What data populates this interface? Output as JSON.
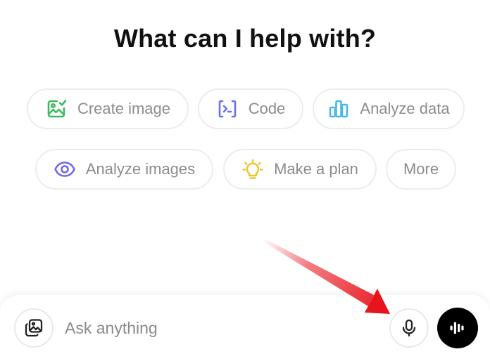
{
  "heading": "What can I help with?",
  "chips": [
    {
      "label": "Create image",
      "icon": "image-add-icon",
      "color": "#3dbb5e"
    },
    {
      "label": "Code",
      "icon": "code-terminal-icon",
      "color": "#6b6ef0"
    },
    {
      "label": "Analyze data",
      "icon": "bar-chart-icon",
      "color": "#4ab7e8"
    },
    {
      "label": "Analyze images",
      "icon": "eye-icon",
      "color": "#7069e8"
    },
    {
      "label": "Make a plan",
      "icon": "lightbulb-icon",
      "color": "#e9c62f"
    },
    {
      "label": "More",
      "icon": "",
      "color": "#8c8c8c"
    }
  ],
  "composer": {
    "placeholder": "Ask anything",
    "attach_icon": "photos-icon",
    "mic_icon": "microphone-icon",
    "voice_icon": "voice-mode-icon"
  },
  "annotation": {
    "arrow_icon": "red-arrow-pointer",
    "color": "#e8141c"
  }
}
